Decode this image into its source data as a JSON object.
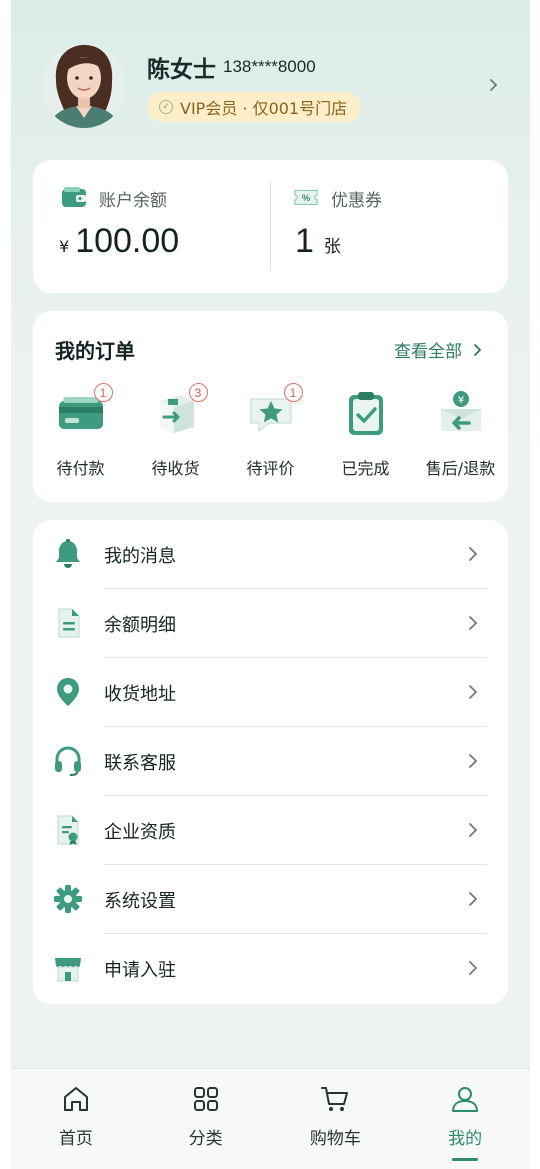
{
  "profile": {
    "name": "陈女士",
    "phone": "138****8000",
    "vip_badge": "VIP会员 · 仅001号门店"
  },
  "wallet": {
    "balance_label": "账户余额",
    "currency": "¥",
    "balance": "100.00",
    "coupon_label": "优惠券",
    "coupon_count": "1",
    "coupon_unit": "张"
  },
  "orders": {
    "title": "我的订单",
    "view_all": "查看全部",
    "items": [
      {
        "label": "待付款",
        "badge": "1",
        "icon": "card-icon"
      },
      {
        "label": "待收货",
        "badge": "3",
        "icon": "package-icon"
      },
      {
        "label": "待评价",
        "badge": "1",
        "icon": "review-icon"
      },
      {
        "label": "已完成",
        "badge": "",
        "icon": "clipboard-check-icon"
      },
      {
        "label": "售后/退款",
        "badge": "",
        "icon": "refund-icon"
      }
    ]
  },
  "menu": {
    "items": [
      {
        "label": "我的消息",
        "icon": "bell-icon"
      },
      {
        "label": "余额明细",
        "icon": "document-icon"
      },
      {
        "label": "收货地址",
        "icon": "location-pin-icon"
      },
      {
        "label": "联系客服",
        "icon": "headset-icon"
      },
      {
        "label": "企业资质",
        "icon": "certificate-icon"
      },
      {
        "label": "系统设置",
        "icon": "gear-icon"
      },
      {
        "label": "申请入驻",
        "icon": "store-icon"
      }
    ]
  },
  "tabbar": {
    "tabs": [
      {
        "label": "首页",
        "icon": "home-icon",
        "active": false
      },
      {
        "label": "分类",
        "icon": "grid-icon",
        "active": false
      },
      {
        "label": "购物车",
        "icon": "cart-icon",
        "active": false
      },
      {
        "label": "我的",
        "icon": "user-icon",
        "active": true
      }
    ]
  },
  "colors": {
    "accent": "#2c8a6e",
    "badge": "#e05a4c",
    "vip_bg": "#fbeec8"
  }
}
